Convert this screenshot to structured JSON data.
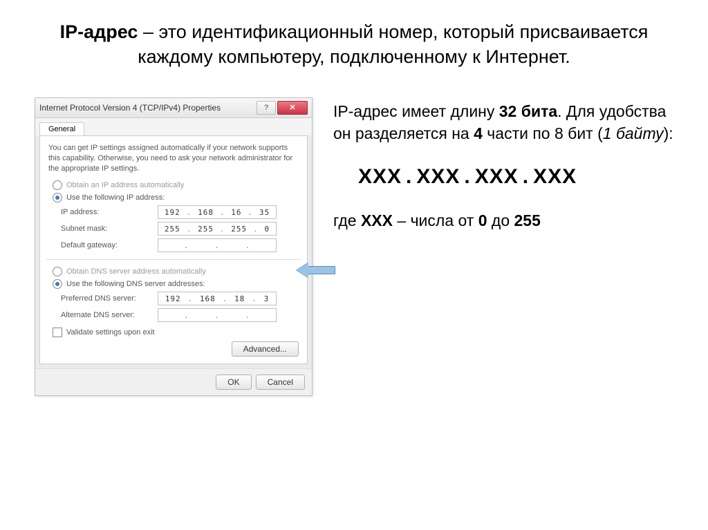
{
  "title": {
    "bold": "IP-адрес",
    "rest": " – это идентификационный номер, который присваивается каждому компьютеру, подключенному к Интернет."
  },
  "dialog": {
    "title": "Internet Protocol Version 4 (TCP/IPv4) Properties",
    "help_icon": "?",
    "close_icon": "✕",
    "tab": "General",
    "info": "You can get IP settings assigned automatically if your network supports this capability. Otherwise, you need to ask your network administrator for the appropriate IP settings.",
    "radio_obtain": "Obtain an IP address automatically",
    "radio_use": "Use the following IP address:",
    "ip_label": "IP address:",
    "ip_value": [
      "192",
      "168",
      "16",
      "35"
    ],
    "mask_label": "Subnet mask:",
    "mask_value": [
      "255",
      "255",
      "255",
      "0"
    ],
    "gw_label": "Default gateway:",
    "gw_value": [
      "",
      "",
      "",
      ""
    ],
    "radio_dns_auto": "Obtain DNS server address automatically",
    "radio_dns_use": "Use the following DNS server addresses:",
    "pdns_label": "Preferred DNS server:",
    "pdns_value": [
      "192",
      "168",
      "18",
      "3"
    ],
    "adns_label": "Alternate DNS server:",
    "adns_value": [
      "",
      "",
      "",
      ""
    ],
    "validate": "Validate settings upon exit",
    "advanced": "Advanced...",
    "ok": "OK",
    "cancel": "Cancel"
  },
  "right": {
    "line1a": "IP-адрес имеет длину ",
    "line1b": "32 бита",
    "line1c": ". Для удобства он разделяется на ",
    "line1d": "4",
    "line1e": " части по 8 бит (",
    "line1f": "1 байту",
    "line1g": "):",
    "pattern_seg": "XXX",
    "line2a": "где ",
    "line2b": "XXX",
    "line2c": " – числа от ",
    "line2d": "0",
    "line2e": " до ",
    "line2f": "255"
  }
}
